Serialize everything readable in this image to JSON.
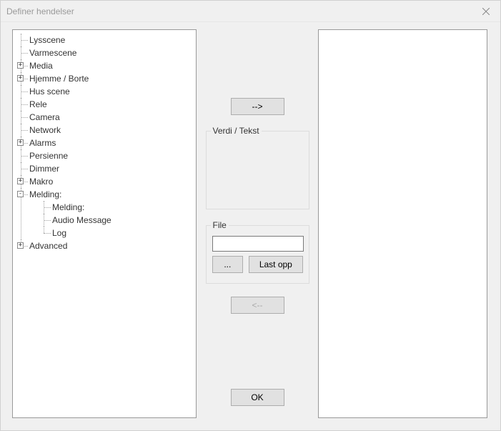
{
  "window": {
    "title": "Definer hendelser"
  },
  "tree": {
    "items": [
      {
        "label": "Lysscene",
        "expandable": false
      },
      {
        "label": "Varmescene",
        "expandable": false
      },
      {
        "label": "Media",
        "expandable": true,
        "expanded": false
      },
      {
        "label": "Hjemme / Borte",
        "expandable": true,
        "expanded": false
      },
      {
        "label": "Hus scene",
        "expandable": false
      },
      {
        "label": "Rele",
        "expandable": false
      },
      {
        "label": "Camera",
        "expandable": false
      },
      {
        "label": "Network",
        "expandable": false
      },
      {
        "label": "Alarms",
        "expandable": true,
        "expanded": false
      },
      {
        "label": "Persienne",
        "expandable": false
      },
      {
        "label": "Dimmer",
        "expandable": false
      },
      {
        "label": "Makro",
        "expandable": true,
        "expanded": false
      },
      {
        "label": "Melding:",
        "expandable": true,
        "expanded": true,
        "children": [
          {
            "label": "Melding:"
          },
          {
            "label": "Audio Message"
          },
          {
            "label": "Log"
          }
        ]
      },
      {
        "label": "Advanced",
        "expandable": true,
        "expanded": false
      }
    ]
  },
  "middle": {
    "arrow_right": "-->",
    "verdi_label": "Verdi / Tekst",
    "file_label": "File",
    "file_value": "",
    "browse_label": "...",
    "upload_label": "Last opp",
    "arrow_left": "<--",
    "ok_label": "OK"
  },
  "icons": {
    "close": "close-icon"
  }
}
